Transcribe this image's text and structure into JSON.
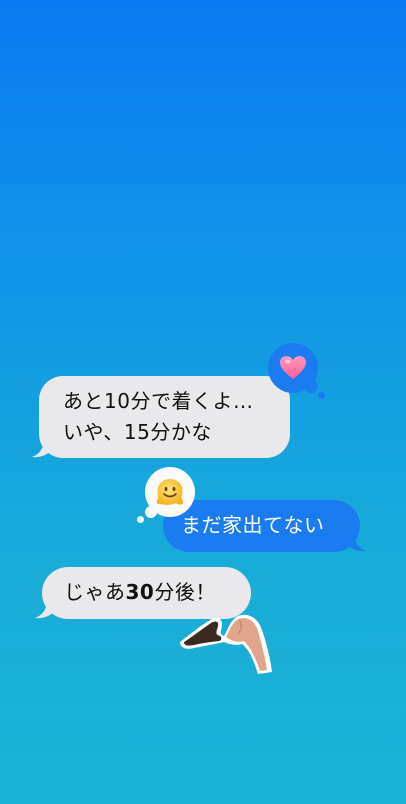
{
  "conversation": {
    "messages": [
      {
        "direction": "received",
        "lines": [
          "あと10分で着くよ…",
          "いや、15分かな"
        ],
        "reaction": "heart-icon"
      },
      {
        "direction": "sent",
        "text": "まだ家出てない",
        "reaction": "melting-face-icon"
      },
      {
        "direction": "received",
        "text_prefix": "じゃあ",
        "text_bold": "30",
        "text_suffix": "分後！",
        "sticker": "heart-hands-sticker"
      }
    ]
  },
  "colors": {
    "background_top": "#0a7af0",
    "background_bottom": "#1ab2d6",
    "received_bubble": "#e9e9eb",
    "sent_bubble": "#1a7cf0",
    "received_text": "#111111",
    "sent_text": "#ffffff",
    "heart": "#ff7aa8"
  }
}
